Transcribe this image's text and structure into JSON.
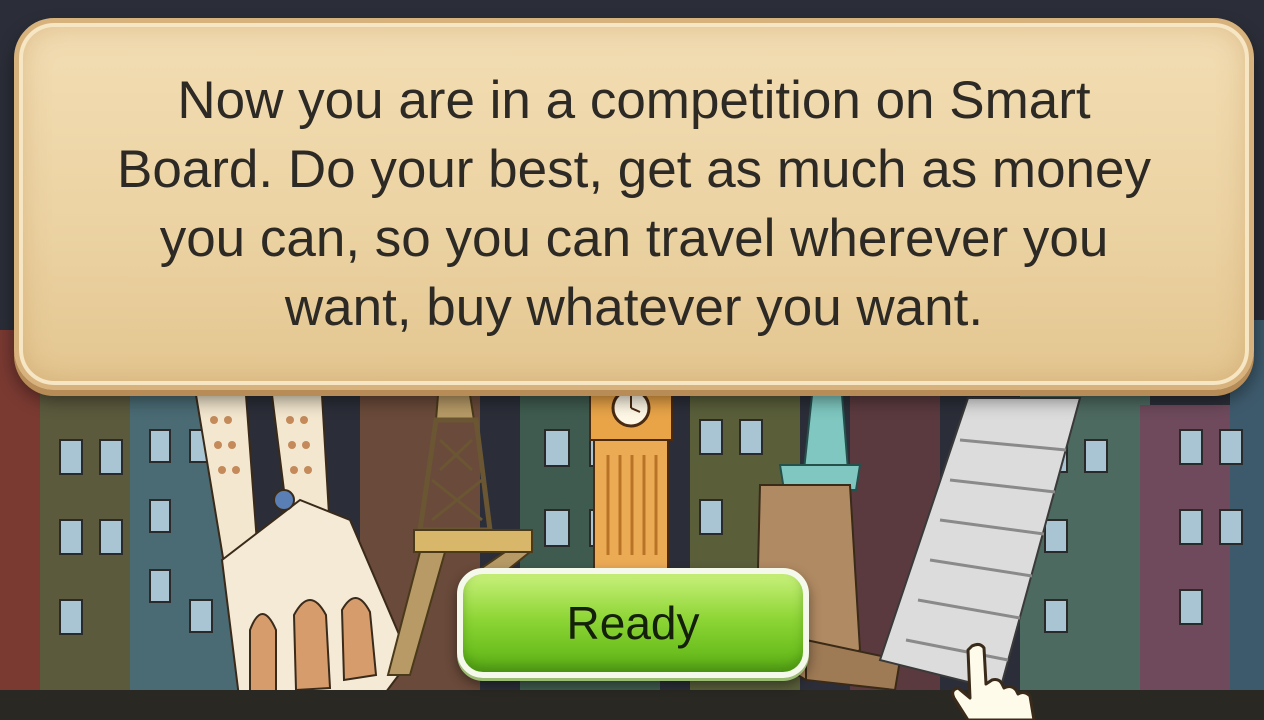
{
  "dialog": {
    "message": "Now you are in a competition on Smart Board. Do your best, get as much as money you can, so you can travel wherever you want, buy whatever you want."
  },
  "ready_button": {
    "label": "Ready"
  },
  "scene": {
    "landmarks": [
      "sagrada-familia",
      "eiffel-tower",
      "big-ben",
      "statue-of-liberty",
      "leaning-tower-of-pisa"
    ]
  },
  "colors": {
    "panel": "#ecd3a3",
    "panel_border": "#d8b27c",
    "button_green": "#8fd637",
    "night_sky": "#2b2e38"
  }
}
